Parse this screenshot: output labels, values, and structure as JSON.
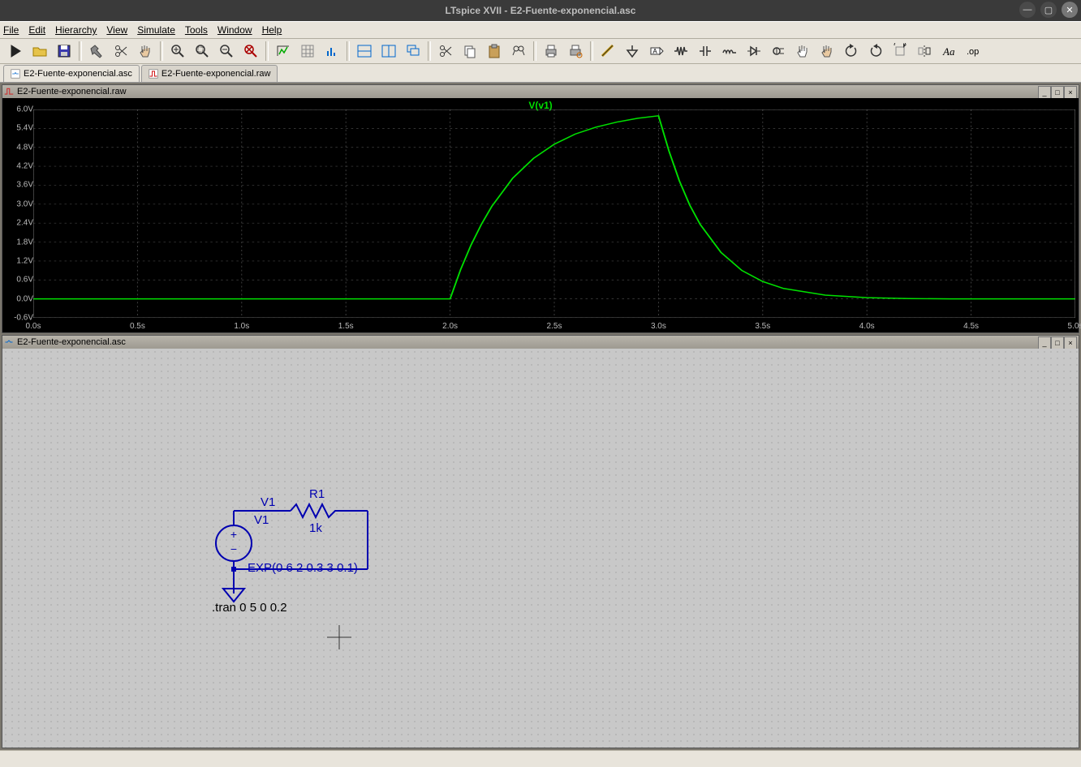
{
  "window": {
    "title": "LTspice XVII - E2-Fuente-exponencial.asc"
  },
  "menus": [
    "File",
    "Edit",
    "Hierarchy",
    "View",
    "Simulate",
    "Tools",
    "Window",
    "Help"
  ],
  "tabs": [
    {
      "label": "E2-Fuente-exponencial.asc",
      "active": true,
      "id": "tab-asc"
    },
    {
      "label": "E2-Fuente-exponencial.raw",
      "active": false,
      "id": "tab-raw"
    }
  ],
  "panes": {
    "plot": {
      "title": "E2-Fuente-exponencial.raw"
    },
    "schem": {
      "title": "E2-Fuente-exponencial.asc"
    }
  },
  "schematic": {
    "net_label": "V1",
    "source_name": "V1",
    "source_value": "EXP(0 6 2 0.3 3 0.1)",
    "resistor_name": "R1",
    "resistor_value": "1k",
    "directive": ".tran 0 5 0 0.2"
  },
  "chart_data": {
    "type": "line",
    "title": "V(v1)",
    "xlabel": "",
    "ylabel": "",
    "xlim": [
      0.0,
      5.0
    ],
    "ylim": [
      -0.6,
      6.0
    ],
    "x_ticks": [
      "0.0s",
      "0.5s",
      "1.0s",
      "1.5s",
      "2.0s",
      "2.5s",
      "3.0s",
      "3.5s",
      "4.0s",
      "4.5s",
      "5.0s"
    ],
    "y_ticks": [
      "-0.6V",
      "0.0V",
      "0.6V",
      "1.2V",
      "1.8V",
      "2.4V",
      "3.0V",
      "3.6V",
      "4.2V",
      "4.8V",
      "5.4V",
      "6.0V"
    ],
    "series": [
      {
        "name": "V(v1)",
        "exp_params": {
          "V1": 0,
          "V2": 6,
          "TD1": 2.0,
          "TAU1": 0.3,
          "TD2": 3.0,
          "TAU2": 0.1
        },
        "x": [
          0.0,
          0.2,
          0.4,
          0.6,
          0.8,
          1.0,
          1.2,
          1.4,
          1.6,
          1.8,
          2.0,
          2.05,
          2.1,
          2.15,
          2.2,
          2.3,
          2.4,
          2.5,
          2.6,
          2.7,
          2.8,
          2.9,
          3.0,
          3.05,
          3.1,
          3.15,
          3.2,
          3.3,
          3.4,
          3.5,
          3.6,
          3.8,
          4.0,
          4.2,
          4.4,
          4.6,
          4.8,
          5.0
        ],
        "values": [
          0,
          0,
          0,
          0,
          0,
          0,
          0,
          0,
          0,
          0,
          0.0,
          0.92,
          1.7,
          2.36,
          2.93,
          3.82,
          4.45,
          4.9,
          5.22,
          5.44,
          5.6,
          5.72,
          5.8,
          4.69,
          3.74,
          2.97,
          2.36,
          1.47,
          0.9,
          0.55,
          0.33,
          0.12,
          0.04,
          0.01,
          0.0,
          0.0,
          0.0,
          0.0
        ]
      }
    ]
  },
  "toolbar_icons": [
    "run",
    "open",
    "save",
    "sep",
    "hammer",
    "scissors",
    "grab",
    "sep",
    "zoom-in",
    "zoom-area",
    "zoom-out",
    "zoom-reset",
    "sep",
    "autoscale",
    "toggle-grid",
    "fft",
    "sep",
    "tile-h",
    "tile-v",
    "cascade",
    "sep",
    "cut",
    "copy",
    "paste",
    "find",
    "sep",
    "print",
    "print-setup",
    "sep",
    "wire",
    "ground",
    "net-label",
    "resistor",
    "capacitor",
    "inductor",
    "diode",
    "component",
    "move",
    "drag",
    "undo",
    "redo",
    "rotate",
    "mirror",
    "text",
    "op"
  ]
}
